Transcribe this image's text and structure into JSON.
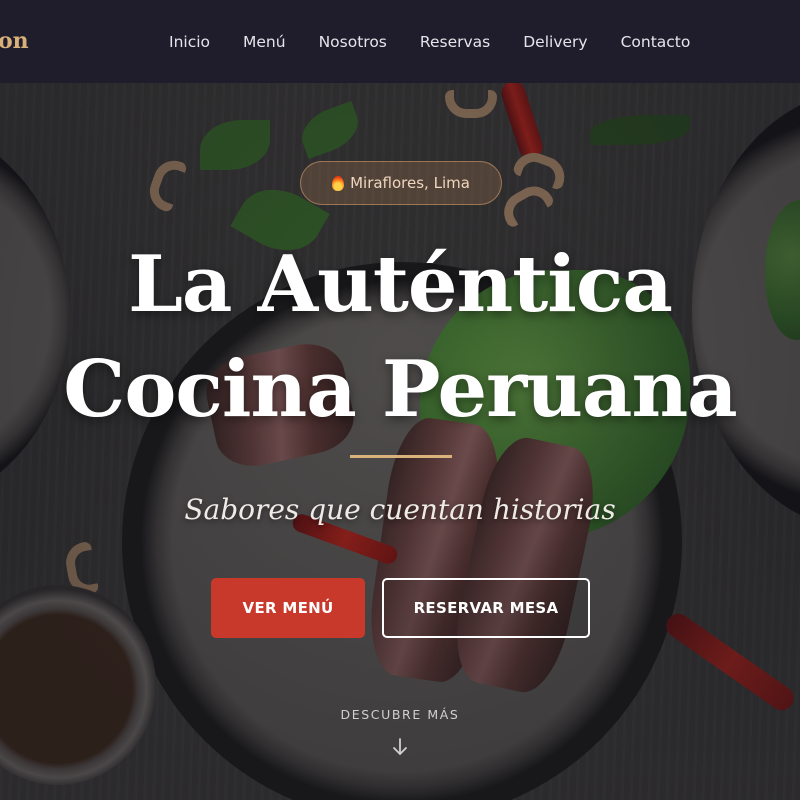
{
  "navbar": {
    "brand": "on",
    "links": [
      "Inicio",
      "Menú",
      "Nosotros",
      "Reservas",
      "Delivery",
      "Contacto"
    ]
  },
  "hero": {
    "location": "Miraflores, Lima",
    "location_icon": "fire-icon",
    "headline_line1": "La Auténtica",
    "headline_line2": "Cocina Peruana",
    "tagline": "Sabores que cuentan historias",
    "primary_button": "VER MENÚ",
    "secondary_button": "RESERVAR MESA",
    "scroll_hint": "DESCUBRE MÁS",
    "scroll_icon": "arrow-down-icon"
  },
  "colors": {
    "navbar_bg": "#1f1d2b",
    "brand": "#d8b07a",
    "primary_button": "#c8392b",
    "divider": "#d9b27c"
  }
}
